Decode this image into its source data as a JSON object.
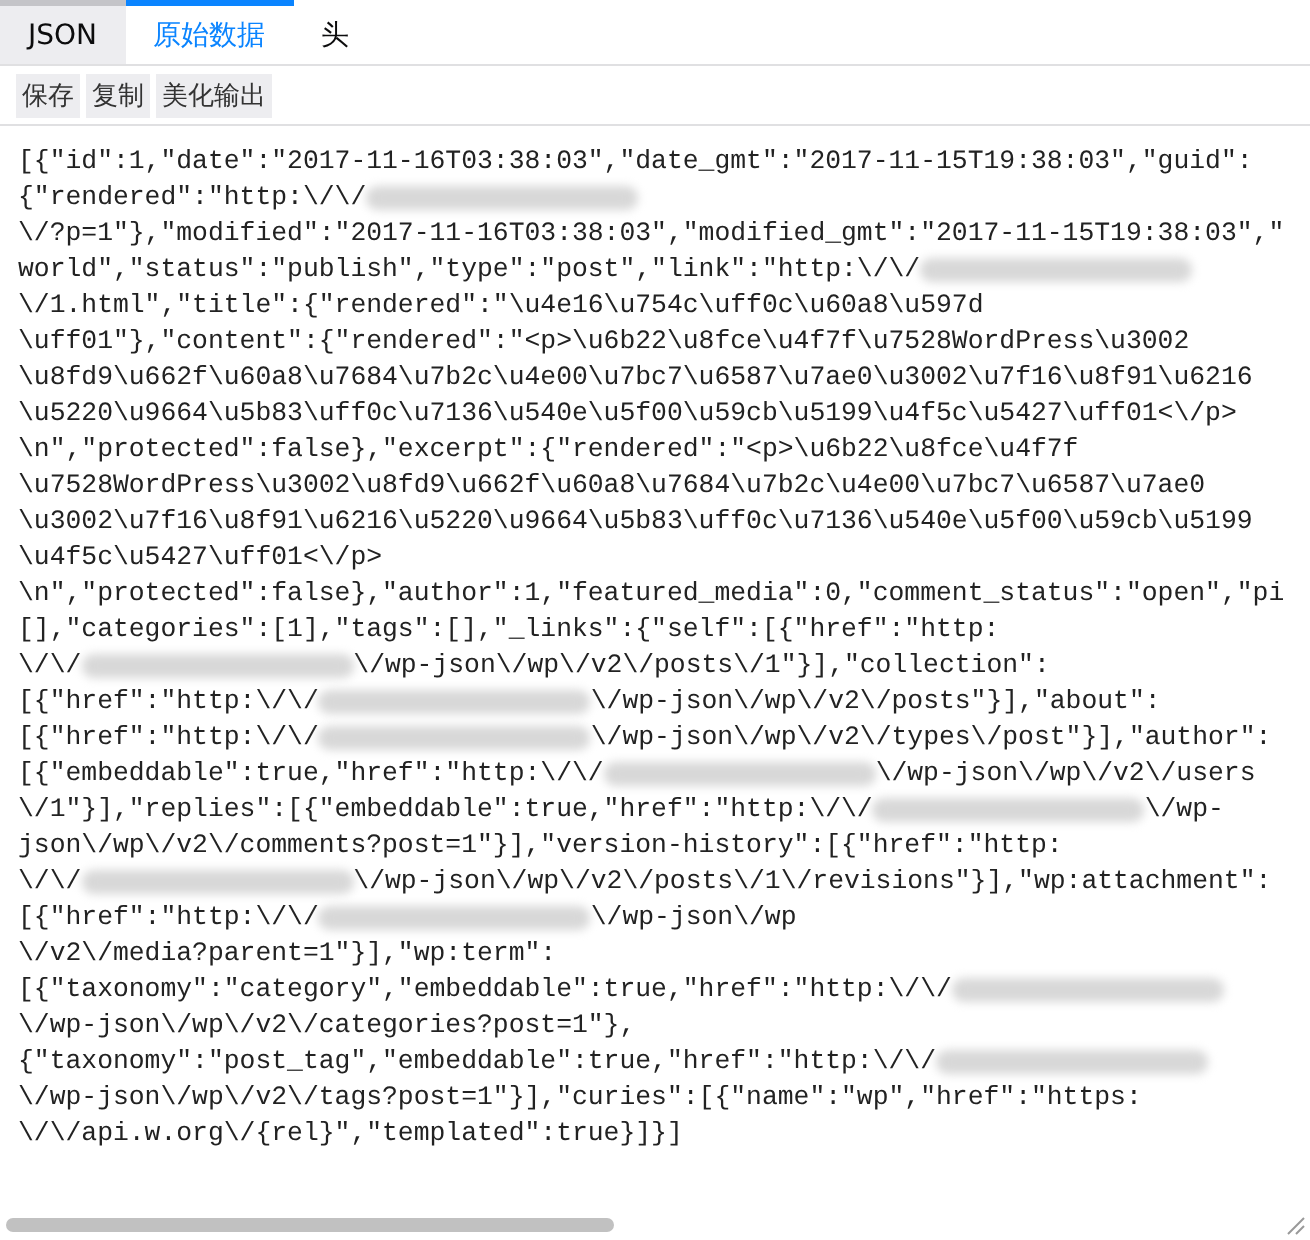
{
  "tabs": [
    {
      "label": "JSON",
      "selected": false
    },
    {
      "label": "原始数据",
      "selected": true
    },
    {
      "label": "头",
      "selected": false
    }
  ],
  "toolbar": [
    "保存",
    "复制",
    "美化输出"
  ],
  "raw_lines": [
    [
      {
        "kind": "text",
        "text": "[{\"id\":1,\"date\":\"2017-11-16T03:38:03\",\"date_gmt\":\"2017-11-15T19:38:03\",\"guid\":"
      }
    ],
    [
      {
        "kind": "text",
        "text": "{\"rendered\":\"http:\\/\\/"
      },
      {
        "kind": "blur"
      }
    ],
    [
      {
        "kind": "text",
        "text": "\\/?p=1\"},\"modified\":\"2017-11-16T03:38:03\",\"modified_gmt\":\"2017-11-15T19:38:03\",\""
      }
    ],
    [
      {
        "kind": "text",
        "text": "world\",\"status\":\"publish\",\"type\":\"post\",\"link\":\"http:\\/\\/"
      },
      {
        "kind": "blur"
      }
    ],
    [
      {
        "kind": "text",
        "text": "\\/1.html\",\"title\":{\"rendered\":\"\\u4e16\\u754c\\uff0c\\u60a8\\u597d"
      }
    ],
    [
      {
        "kind": "text",
        "text": "\\uff01\"},\"content\":{\"rendered\":\"<p>\\u6b22\\u8fce\\u4f7f\\u7528WordPress\\u3002"
      }
    ],
    [
      {
        "kind": "text",
        "text": "\\u8fd9\\u662f\\u60a8\\u7684\\u7b2c\\u4e00\\u7bc7\\u6587\\u7ae0\\u3002\\u7f16\\u8f91\\u6216"
      }
    ],
    [
      {
        "kind": "text",
        "text": "\\u5220\\u9664\\u5b83\\uff0c\\u7136\\u540e\\u5f00\\u59cb\\u5199\\u4f5c\\u5427\\uff01<\\/p>"
      }
    ],
    [
      {
        "kind": "text",
        "text": "\\n\",\"protected\":false},\"excerpt\":{\"rendered\":\"<p>\\u6b22\\u8fce\\u4f7f"
      }
    ],
    [
      {
        "kind": "text",
        "text": "\\u7528WordPress\\u3002\\u8fd9\\u662f\\u60a8\\u7684\\u7b2c\\u4e00\\u7bc7\\u6587\\u7ae0"
      }
    ],
    [
      {
        "kind": "text",
        "text": "\\u3002\\u7f16\\u8f91\\u6216\\u5220\\u9664\\u5b83\\uff0c\\u7136\\u540e\\u5f00\\u59cb\\u5199"
      }
    ],
    [
      {
        "kind": "text",
        "text": "\\u4f5c\\u5427\\uff01<\\/p>"
      }
    ],
    [
      {
        "kind": "text",
        "text": "\\n\",\"protected\":false},\"author\":1,\"featured_media\":0,\"comment_status\":\"open\",\"pi"
      }
    ],
    [
      {
        "kind": "text",
        "text": "[],\"categories\":[1],\"tags\":[],\"_links\":{\"self\":[{\"href\":\"http:"
      }
    ],
    [
      {
        "kind": "text",
        "text": "\\/\\/"
      },
      {
        "kind": "blur"
      },
      {
        "kind": "text",
        "text": "\\/wp-json\\/wp\\/v2\\/posts\\/1\"}],\"collection\":"
      }
    ],
    [
      {
        "kind": "text",
        "text": "[{\"href\":\"http:\\/\\/"
      },
      {
        "kind": "blur"
      },
      {
        "kind": "text",
        "text": "\\/wp-json\\/wp\\/v2\\/posts\"}],\"about\":"
      }
    ],
    [
      {
        "kind": "text",
        "text": "[{\"href\":\"http:\\/\\/"
      },
      {
        "kind": "blur"
      },
      {
        "kind": "text",
        "text": "\\/wp-json\\/wp\\/v2\\/types\\/post\"}],\"author\":"
      }
    ],
    [
      {
        "kind": "text",
        "text": "[{\"embeddable\":true,\"href\":\"http:\\/\\/"
      },
      {
        "kind": "blur"
      },
      {
        "kind": "text",
        "text": "\\/wp-json\\/wp\\/v2\\/users"
      }
    ],
    [
      {
        "kind": "text",
        "text": "\\/1\"}],\"replies\":[{\"embeddable\":true,\"href\":\"http:\\/\\/"
      },
      {
        "kind": "blur"
      },
      {
        "kind": "text",
        "text": "\\/wp-"
      }
    ],
    [
      {
        "kind": "text",
        "text": "json\\/wp\\/v2\\/comments?post=1\"}],\"version-history\":[{\"href\":\"http:"
      }
    ],
    [
      {
        "kind": "text",
        "text": "\\/\\/"
      },
      {
        "kind": "blur"
      },
      {
        "kind": "text",
        "text": "\\/wp-json\\/wp\\/v2\\/posts\\/1\\/revisions\"}],\"wp:attachment\":"
      }
    ],
    [
      {
        "kind": "text",
        "text": "[{\"href\":\"http:\\/\\/"
      },
      {
        "kind": "blur"
      },
      {
        "kind": "text",
        "text": "\\/wp-json\\/wp"
      }
    ],
    [
      {
        "kind": "text",
        "text": "\\/v2\\/media?parent=1\"}],\"wp:term\":"
      }
    ],
    [
      {
        "kind": "text",
        "text": "[{\"taxonomy\":\"category\",\"embeddable\":true,\"href\":\"http:\\/\\/"
      },
      {
        "kind": "blur"
      }
    ],
    [
      {
        "kind": "text",
        "text": "\\/wp-json\\/wp\\/v2\\/categories?post=1\"},"
      }
    ],
    [
      {
        "kind": "text",
        "text": "{\"taxonomy\":\"post_tag\",\"embeddable\":true,\"href\":\"http:\\/\\/"
      },
      {
        "kind": "blur"
      }
    ],
    [
      {
        "kind": "text",
        "text": "\\/wp-json\\/wp\\/v2\\/tags?post=1\"}],\"curies\":[{\"name\":\"wp\",\"href\":\"https:"
      }
    ],
    [
      {
        "kind": "text",
        "text": "\\/\\/api.w.org\\/{rel}\",\"templated\":true}]}]"
      }
    ]
  ]
}
